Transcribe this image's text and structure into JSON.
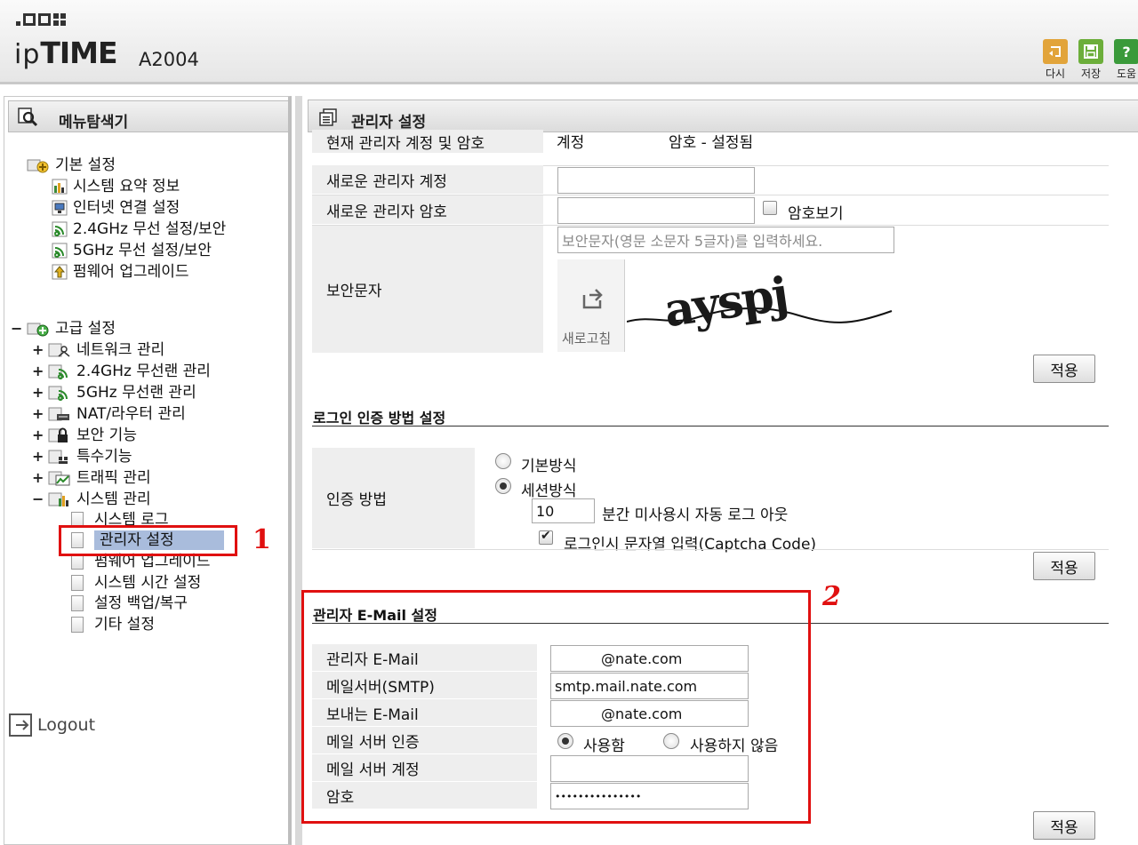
{
  "header": {
    "model": "A2004",
    "buttons": [
      {
        "label": "다시",
        "icon": "undo-icon",
        "color": "#e2a43a"
      },
      {
        "label": "저장",
        "icon": "save-icon",
        "color": "#6cae3a"
      },
      {
        "label": "도움",
        "icon": "help-icon",
        "color": "#3a9a3a"
      }
    ]
  },
  "sidebar": {
    "title": "메뉴탐색기",
    "groups": [
      {
        "label": "기본 설정"
      },
      {
        "label": "고급 설정"
      }
    ],
    "basic_items": [
      "시스템 요약 정보",
      "인터넷 연결 설정",
      "2.4GHz 무선 설정/보안",
      "5GHz 무선 설정/보안",
      "펌웨어 업그레이드"
    ],
    "advanced_items": [
      "네트워크 관리",
      "2.4GHz 무선랜 관리",
      "5GHz 무선랜 관리",
      "NAT/라우터 관리",
      "보안 기능",
      "특수기능",
      "트래픽 관리",
      "시스템 관리"
    ],
    "system_items": [
      "시스템 로그",
      "관리자 설정",
      "펌웨어 업그레이드",
      "시스템 시간 설정",
      "설정 백업/복구",
      "기타 설정"
    ],
    "logout": "Logout",
    "annotation": "1"
  },
  "main": {
    "title": "관리자 설정",
    "account": {
      "current_label": "현재 관리자 계정 및 암호",
      "current_account_label": "계정",
      "current_password_label": "암호 - 설정됨",
      "new_account_label": "새로운 관리자 계정",
      "new_password_label": "새로운 관리자 암호",
      "show_password_label": "암호보기",
      "captcha_label": "보안문자",
      "captcha_placeholder": "보안문자(영문 소문자 5글자)를 입력하세요.",
      "refresh_label": "새로고침",
      "captcha_text": "ayspj",
      "apply": "적용"
    },
    "login_auth": {
      "title": "로그인 인증 방법 설정",
      "label": "인증 방법",
      "option_basic": "기본방식",
      "option_session": "세션방식",
      "timeout_value": "10",
      "timeout_suffix": "분간 미사용시 자동 로그 아웃",
      "captcha_check_label": "로그인시 문자열 입력(Captcha Code)",
      "apply": "적용"
    },
    "email": {
      "title": "관리자 E-Mail 설정",
      "rows": [
        {
          "label": "관리자 E-Mail",
          "value": "@nate.com"
        },
        {
          "label": "메일서버(SMTP)",
          "value": "smtp.mail.nate.com"
        },
        {
          "label": "보내는 E-Mail",
          "value": "@nate.com"
        },
        {
          "label": "메일 서버 인증",
          "value": ""
        },
        {
          "label": "메일 서버 계정",
          "value": ""
        },
        {
          "label": "암호",
          "value": "•••••••••••••••"
        }
      ],
      "auth_use": "사용함",
      "auth_nouse": "사용하지 않음",
      "apply": "적용",
      "annotation": "2"
    }
  }
}
